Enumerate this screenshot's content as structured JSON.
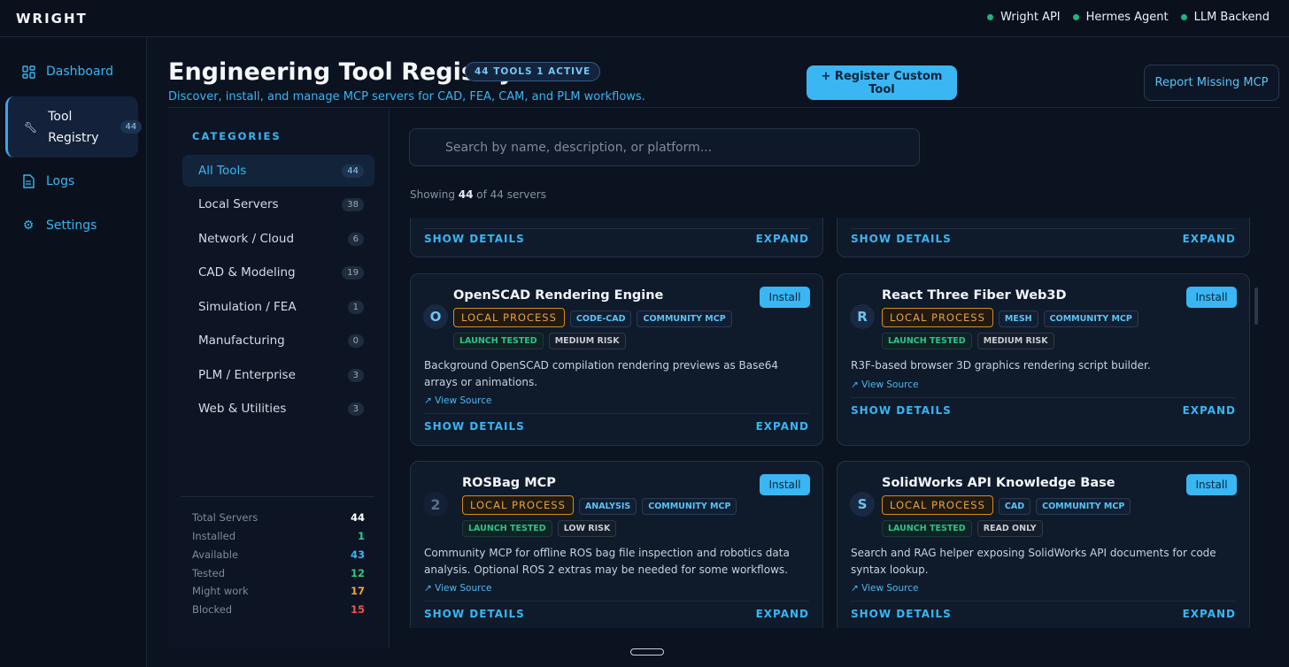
{
  "app": {
    "brand": "WRIGHT",
    "status": [
      {
        "label": "Wright API",
        "color": "#1fb57a"
      },
      {
        "label": "Hermes Agent",
        "color": "#1fb57a"
      },
      {
        "label": "LLM Backend",
        "color": "#1fb57a"
      }
    ]
  },
  "nav": {
    "items": [
      {
        "label": "Dashboard",
        "icon": "grid-icon"
      },
      {
        "label_line1": "Tool",
        "label_line2": "Registry",
        "icon": "wrench-icon",
        "badge": "44",
        "active": true
      },
      {
        "label": "Logs",
        "icon": "document-icon"
      },
      {
        "label": "Settings",
        "icon": "gear-icon"
      }
    ]
  },
  "header": {
    "title": "Engineering Tool Registry",
    "count_pill": "44 TOOLS 1 ACTIVE",
    "subtitle": "Discover, install, and manage MCP servers for CAD, FEA, CAM, and PLM workflows.",
    "register_button": "+ Register Custom Tool",
    "report_button": "Report Missing MCP"
  },
  "categories": {
    "heading": "CATEGORIES",
    "items": [
      {
        "label": "All Tools",
        "count": "44",
        "active": true
      },
      {
        "label": "Local Servers",
        "count": "38"
      },
      {
        "label": "Network / Cloud",
        "count": "6"
      },
      {
        "label": "CAD & Modeling",
        "count": "19"
      },
      {
        "label": "Simulation / FEA",
        "count": "1"
      },
      {
        "label": "Manufacturing",
        "count": "0"
      },
      {
        "label": "PLM / Enterprise",
        "count": "3"
      },
      {
        "label": "Web & Utilities",
        "count": "3"
      }
    ],
    "stats": [
      {
        "label": "Total Servers",
        "value": "44",
        "color": "#ffffff"
      },
      {
        "label": "Installed",
        "value": "1",
        "color": "#2fc98a"
      },
      {
        "label": "Available",
        "value": "43",
        "color": "#38b6f2"
      },
      {
        "label": "Tested",
        "value": "12",
        "color": "#2fc98a"
      },
      {
        "label": "Might work",
        "value": "17",
        "color": "#f0a534"
      },
      {
        "label": "Blocked",
        "value": "15",
        "color": "#ef5350"
      }
    ]
  },
  "search": {
    "placeholder": "Search by name, description, or platform...",
    "showing_prefix": "Showing ",
    "showing_count": "44",
    "showing_suffix": " of 44 servers"
  },
  "cards": {
    "show_details": "SHOW DETAILS",
    "expand": "EXPAND",
    "install": "Install",
    "view_source": "↗ View Source",
    "items": [
      {
        "title": "OpenSCAD Rendering Engine",
        "avatar": "O",
        "process": "LOCAL PROCESS",
        "tags": [
          "CODE-CAD",
          "COMMUNITY MCP"
        ],
        "tested": "LAUNCH TESTED",
        "risk": "MEDIUM RISK",
        "desc": "Background OpenSCAD compilation rendering previews as Base64 arrays or animations."
      },
      {
        "title": "React Three Fiber Web3D",
        "avatar": "R",
        "process": "LOCAL PROCESS",
        "tags": [
          "MESH",
          "COMMUNITY MCP"
        ],
        "tested": "LAUNCH TESTED",
        "risk": "MEDIUM RISK",
        "desc": "R3F-based browser 3D graphics rendering script builder."
      },
      {
        "title": "ROSBag MCP",
        "avatar": "2",
        "process": "LOCAL PROCESS",
        "tags": [
          "ANALYSIS",
          "COMMUNITY MCP"
        ],
        "tested": "LAUNCH TESTED",
        "risk": "LOW RISK",
        "desc": "Community MCP for offline ROS bag file inspection and robotics data analysis. Optional ROS 2 extras may be needed for some workflows."
      },
      {
        "title": "SolidWorks API Knowledge Base",
        "avatar": "S",
        "process": "LOCAL PROCESS",
        "tags": [
          "CAD",
          "COMMUNITY MCP"
        ],
        "tested": "LAUNCH TESTED",
        "risk": "READ ONLY",
        "desc": "Search and RAG helper exposing SolidWorks API documents for code syntax lookup."
      }
    ]
  }
}
